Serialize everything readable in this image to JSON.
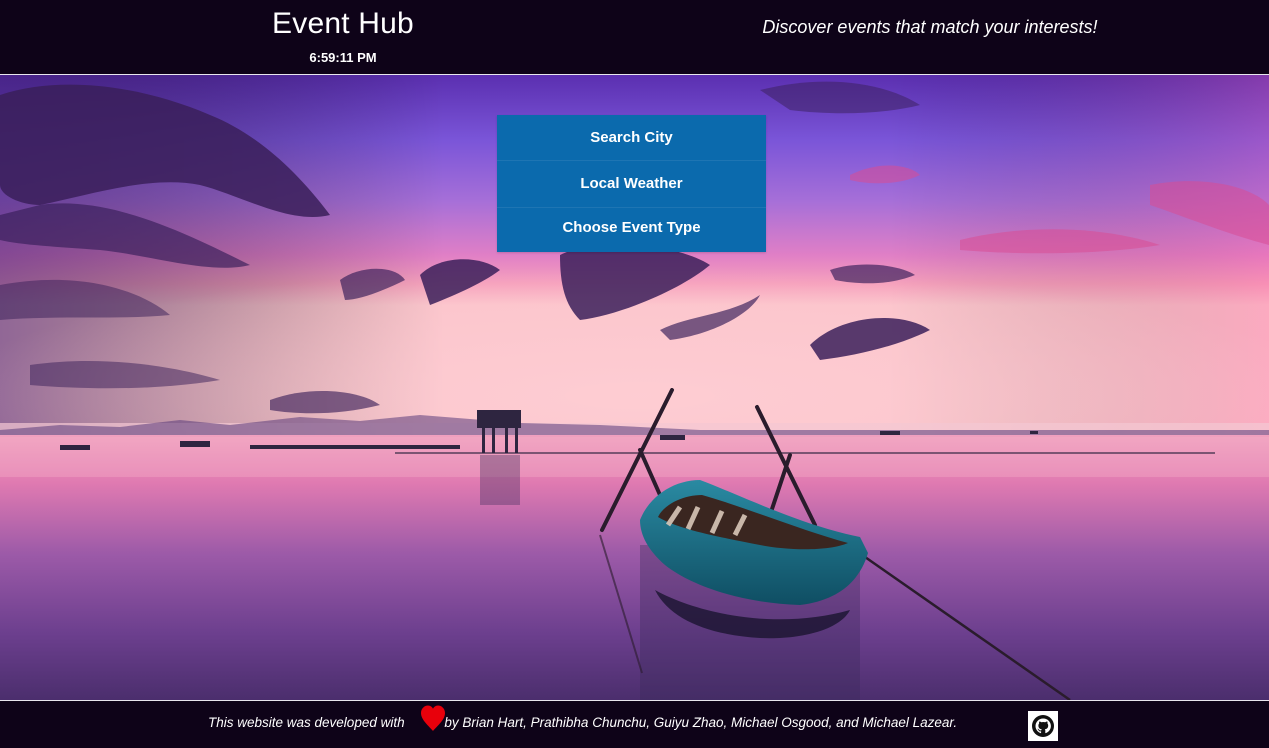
{
  "header": {
    "title": "Event Hub",
    "clock": "6:59:11 PM",
    "tagline": "Discover events that match your interests!"
  },
  "menu": {
    "items": [
      {
        "label": "Search City"
      },
      {
        "label": "Local Weather"
      },
      {
        "label": "Choose Event Type"
      }
    ]
  },
  "footer": {
    "text_before": "This website was developed with",
    "text_after": "by Brian Hart, Prathibha Chunchu, Guiyu Zhao, Michael Osgood, and Michael Lazear.",
    "heart_icon": "heart-icon",
    "github_icon": "github-icon"
  },
  "colors": {
    "bar_background": "#0e0318",
    "menu_background": "#0b6aad",
    "heart": "#e8000b"
  }
}
